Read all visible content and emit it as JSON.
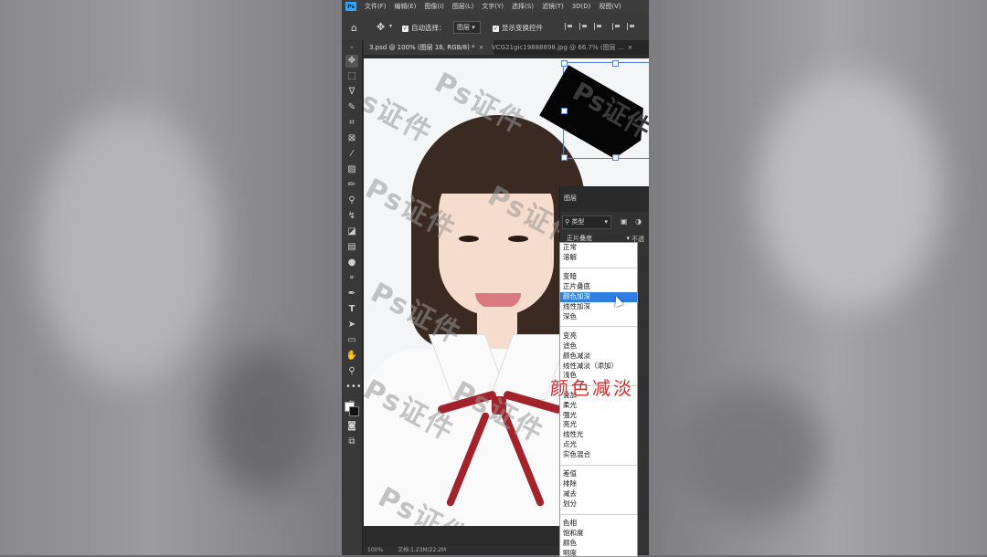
{
  "menubar": {
    "logo": "Ps",
    "items": [
      "文件(F)",
      "编辑(E)",
      "图像(I)",
      "图层(L)",
      "文字(Y)",
      "选择(S)",
      "滤镜(T)",
      "3D(D)",
      "视图(V)"
    ]
  },
  "options": {
    "auto_select_label": "自动选择：",
    "auto_select_target": "图层",
    "show_transform_label": "显示变换控件"
  },
  "tabs": [
    {
      "label": "3.psd @ 100% (图层 16, RGB/8) *",
      "active": true
    },
    {
      "label": "VCG21gic19888898.jpg @ 66.7% (图层 ...",
      "active": false
    }
  ],
  "watermark_text": "Ps证件",
  "layers_panel": {
    "title": "图层",
    "filter_label": "类型",
    "blend_mode": "正片叠底",
    "opacity_label": "不透"
  },
  "blend_menu": [
    {
      "label": "正常"
    },
    {
      "label": "溶解"
    },
    {
      "sep": true
    },
    {
      "label": "变暗"
    },
    {
      "label": "正片叠底"
    },
    {
      "label": "颜色加深",
      "highlighted": true
    },
    {
      "label": "线性加深"
    },
    {
      "label": "深色"
    },
    {
      "sep": true
    },
    {
      "label": "变亮"
    },
    {
      "label": "滤色"
    },
    {
      "label": "颜色减淡"
    },
    {
      "label": "线性减淡（添加）"
    },
    {
      "label": "浅色"
    },
    {
      "sep": true
    },
    {
      "label": "叠加"
    },
    {
      "label": "柔光"
    },
    {
      "label": "强光"
    },
    {
      "label": "亮光"
    },
    {
      "label": "线性光"
    },
    {
      "label": "点光"
    },
    {
      "label": "实色混合"
    },
    {
      "sep": true
    },
    {
      "label": "差值"
    },
    {
      "label": "排除"
    },
    {
      "label": "减去"
    },
    {
      "label": "划分"
    },
    {
      "sep": true
    },
    {
      "label": "色相"
    },
    {
      "label": "饱和度"
    },
    {
      "label": "颜色"
    },
    {
      "label": "明度"
    }
  ],
  "caption": "颜色减淡",
  "status": {
    "zoom": "100%",
    "doc": "文档:1.23M/22.2M"
  },
  "colors": {
    "accent": "#2f7fe2",
    "caption_red": "#d42a2a",
    "ps_blue": "#31a8ff"
  }
}
